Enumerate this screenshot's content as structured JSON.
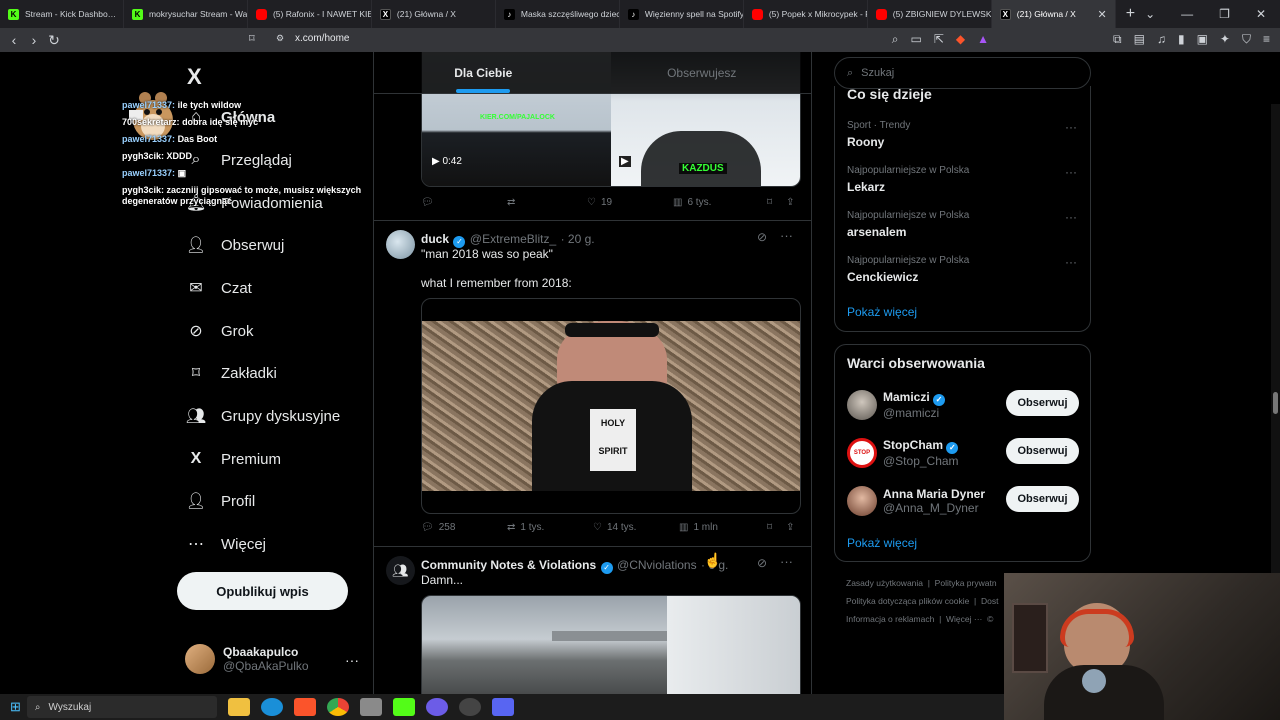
{
  "browser": {
    "tabs": [
      {
        "title": "Stream - Kick Dashbo…",
        "favicon": "kick"
      },
      {
        "title": "mokrysuchar Stream - Wa…",
        "favicon": "kick"
      },
      {
        "title": "(5) Rafonix - I NAWET KIE…",
        "favicon": "youtube"
      },
      {
        "title": "(21) Główna / X",
        "favicon": "x"
      },
      {
        "title": "Maska szczęśliwego dziec…",
        "favicon": "tiktok"
      },
      {
        "title": "Więzienny spell na Spotify",
        "favicon": "tiktok"
      },
      {
        "title": "(5) Popek x Mikrocypek - F…",
        "favicon": "youtube"
      },
      {
        "title": "(5) ZBIGNIEW DYLEWSKI…",
        "favicon": "youtube"
      },
      {
        "title": "(21) Główna / X",
        "favicon": "x",
        "active": true
      }
    ],
    "url": "x.com/home"
  },
  "chat": [
    {
      "user": "pawel71337:",
      "text": "ile tych wildow"
    },
    {
      "user": "700sekretarz:",
      "text": "dobra idę się myć"
    },
    {
      "user": "pawel71337:",
      "text": "Das Boot"
    },
    {
      "user": "pygh3cik:",
      "text": "XDDD"
    },
    {
      "user": "pawel71337:",
      "text": ""
    },
    {
      "user": "pygh3cik:",
      "text": "zaczniij gipsować to może, musisz większych degeneratów przyciągnąć"
    }
  ],
  "sidebar": {
    "logo": "X",
    "items": [
      {
        "label": "Główna",
        "icon": "home-icon"
      },
      {
        "label": "Przeglądaj",
        "icon": "search-icon"
      },
      {
        "label": "Powiadomienia",
        "icon": "bell-icon"
      },
      {
        "label": "Obserwuj",
        "icon": "follow-icon"
      },
      {
        "label": "Czat",
        "icon": "mail-icon"
      },
      {
        "label": "Grok",
        "icon": "grok-icon"
      },
      {
        "label": "Zakładki",
        "icon": "bookmark-icon"
      },
      {
        "label": "Grupy dyskusyjne",
        "icon": "communities-icon"
      },
      {
        "label": "Premium",
        "icon": "x-icon"
      },
      {
        "label": "Profil",
        "icon": "profile-icon"
      },
      {
        "label": "Więcej",
        "icon": "more-icon"
      }
    ],
    "post_button": "Opublikuj wpis",
    "account": {
      "name": "Qbaakapulco",
      "handle": "@QbaAkaPulko"
    }
  },
  "feed": {
    "tabs": [
      "Dla Ciebie",
      "Obserwujesz"
    ],
    "tweet1": {
      "video_duration": "0:42",
      "watermark1": "KIER.COM/PAJALOCK",
      "watermark2": "KAZDUS",
      "stats": {
        "replies": "",
        "reposts": "",
        "likes": "19",
        "views": "6 tys."
      }
    },
    "tweet2": {
      "name": "duck",
      "handle": "@ExtremeBlitz_",
      "time": "· 20 g.",
      "text1": "\"man 2018 was so peak\"",
      "text2": "what I remember from 2018:",
      "shirt_text": "HOLY SPIRIT",
      "stats": {
        "replies": "258",
        "reposts": "1 tys.",
        "likes": "14 tys.",
        "views": "1 mln"
      }
    },
    "tweet3": {
      "name": "Community Notes & Violations",
      "handle": "@CNviolations",
      "time": "· 6 g.",
      "text": "Damn..."
    }
  },
  "right": {
    "search_placeholder": "Szukaj",
    "trends_title": "Co się dzieje",
    "trends": [
      {
        "category": "Sport · Trendy",
        "name": "Roony"
      },
      {
        "category": "Najpopularniejsze w Polska",
        "name": "Lekarz"
      },
      {
        "category": "Najpopularniejsze w Polska",
        "name": "arsenalem"
      },
      {
        "category": "Najpopularniejsze w Polska",
        "name": "Cenckiewicz"
      }
    ],
    "show_more": "Pokaż więcej",
    "follow_title": "Warci obserwowania",
    "follow": [
      {
        "name": "Mamiczi",
        "handle": "@mamiczi",
        "button": "Obserwuj"
      },
      {
        "name": "StopCham",
        "handle": "@Stop_Cham",
        "button": "Obserwuj"
      },
      {
        "name": "Anna Maria Dyner",
        "handle": "@Anna_M_Dyner",
        "button": "Obserwuj"
      }
    ],
    "show_more2": "Pokaż więcej",
    "footer": {
      "line1a": "Zasady użytkowania",
      "line1b": "Polityka prywatn",
      "line2a": "Polityka dotycząca plików cookie",
      "line2b": "Dost",
      "line3a": "Informacja o reklamach",
      "line3b": "Więcej ···",
      "line3c": "©"
    }
  },
  "taskbar": {
    "search": "Wyszukaj"
  }
}
